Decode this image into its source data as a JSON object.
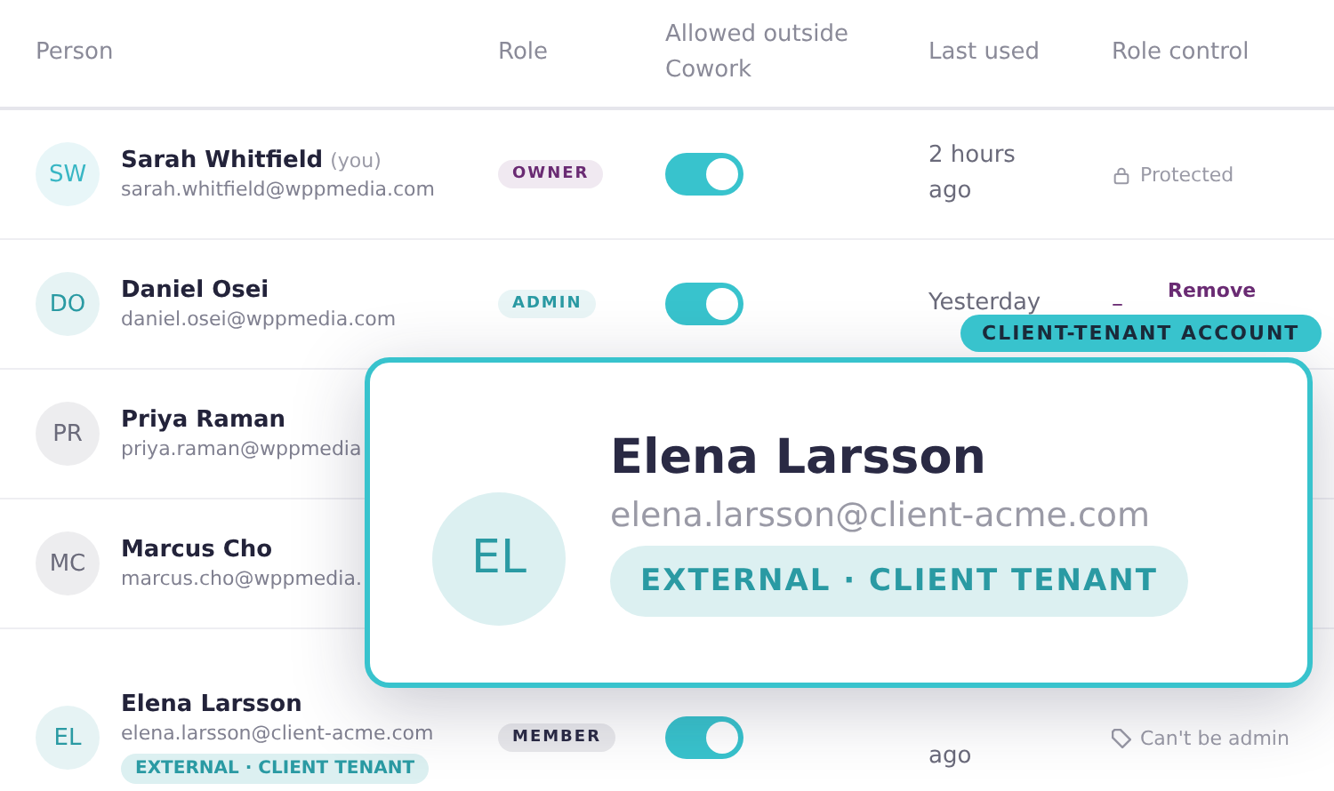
{
  "columns": [
    "Person",
    "Role",
    "Allowed outside Cowork",
    "Last used",
    "Role control"
  ],
  "rows": [
    {
      "initials": "SW",
      "color": "#38b6c4",
      "name": "Sarah Whitfield",
      "you": "(you)",
      "email": "sarah.whitfield@wppmedia.com",
      "role": {
        "text": "OWNER",
        "color": "#6a2b73"
      },
      "allowed": {
        "on": true
      },
      "last_used": "2 hours ago",
      "control": {
        "kind": "protected",
        "text": "Protected"
      }
    },
    {
      "initials": "DO",
      "color": "#2a9aa3",
      "name": "Daniel Osei",
      "email": "daniel.osei@wppmedia.com",
      "role": {
        "text": "ADMIN",
        "color": "#2a9aa3"
      },
      "allowed": {
        "on": true
      },
      "last_used": "Yesterday",
      "control": {
        "kind": "remove",
        "dash": "–",
        "text": "Remove"
      }
    },
    {
      "initials": "PR",
      "color": "#6a6a7a",
      "name": "Priya Raman",
      "email": "priya.raman@wppmedia"
    },
    {
      "initials": "MC",
      "color": "#6a6a7a",
      "name": "Marcus Cho",
      "email": "marcus.cho@wppmedia."
    },
    {
      "initials": "EL",
      "color": "#2a9aa3",
      "name": "Elena Larsson",
      "email": "elena.larsson@client-acme.com",
      "tag": "EXTERNAL · CLIENT TENANT",
      "role": {
        "text": "MEMBER",
        "color": "#2a2a44"
      },
      "allowed": {
        "on": true
      },
      "last_used": "ago",
      "control": {
        "kind": "restricted",
        "text": "Can't be admin"
      }
    }
  ],
  "zoom_card": {
    "badge": "CLIENT-TENANT ACCOUNT",
    "initials": "EL",
    "name": "Elena Larsson",
    "email": "elena.larsson@client-acme.com",
    "tag": "EXTERNAL · CLIENT TENANT"
  }
}
